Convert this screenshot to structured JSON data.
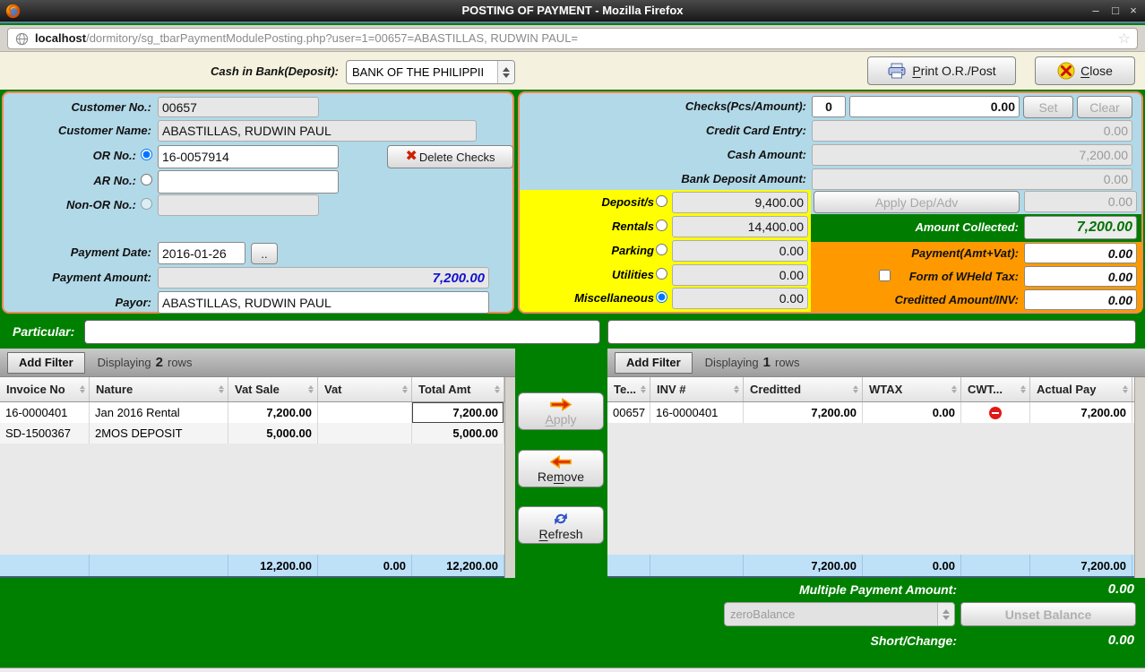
{
  "window": {
    "title": "POSTING OF PAYMENT - Mozilla Firefox",
    "minimize": "–",
    "maximize": "□",
    "close": "×"
  },
  "urlbar": {
    "host": "localhost",
    "path": "/dormitory/sg_tbarPaymentModulePosting.php?user=1=00657=ABASTILLAS, RUDWIN PAUL=",
    "star_icon": "☆"
  },
  "topbar": {
    "cash_in_bank_label": "Cash in Bank(Deposit):",
    "bank_value": "BANK OF THE PHILIPPII",
    "print_label": "Print O.R./Post",
    "print_hotkey": "P",
    "close_label": "Close",
    "close_hotkey": "C"
  },
  "customer": {
    "customer_no_label": "Customer No.:",
    "customer_no": "00657",
    "customer_name_label": "Customer Name:",
    "customer_name": "ABASTILLAS, RUDWIN PAUL",
    "or_no_label": "OR No.:",
    "or_no": "16-0057914",
    "or_selected": true,
    "ar_no_label": "AR No.:",
    "ar_no": "",
    "ar_selected": false,
    "non_or_label": "Non-OR No.:",
    "non_or": "",
    "non_or_selected": false,
    "delete_checks_label": "Delete Checks",
    "payment_date_label": "Payment Date:",
    "payment_date": "2016-01-26",
    "date_button": "..",
    "payment_amount_label": "Payment Amount:",
    "payment_amount": "7,200.00",
    "payor_label": "Payor:",
    "payor": "ABASTILLAS, RUDWIN PAUL"
  },
  "charges": {
    "checks_label": "Checks(Pcs/Amount):",
    "checks_pcs": "0",
    "checks_amount": "0.00",
    "set_label": "Set",
    "clear_label": "Clear",
    "credit_card_label": "Credit Card Entry:",
    "credit_card": "0.00",
    "cash_label": "Cash Amount:",
    "cash_amount": "7,200.00",
    "bank_deposit_label": "Bank Deposit Amount:",
    "bank_deposit": "0.00",
    "categories": [
      {
        "label": "Deposit/s",
        "value": "9,400.00",
        "selected": false
      },
      {
        "label": "Rentals",
        "value": "14,400.00",
        "selected": false
      },
      {
        "label": "Parking",
        "value": "0.00",
        "selected": false
      },
      {
        "label": "Utilities",
        "value": "0.00",
        "selected": false
      },
      {
        "label": "Miscellaneous",
        "value": "0.00",
        "selected": true
      }
    ],
    "apply_dep_label": "Apply Dep/Adv",
    "apply_dep_value": "0.00",
    "amount_collected_label": "Amount Collected:",
    "amount_collected": "7,200.00",
    "payment_vat_label": "Payment(Amt+Vat):",
    "payment_vat": "0.00",
    "wheld_label": "Form of WHeld Tax:",
    "wheld_value": "0.00",
    "wheld_checked": false,
    "creditted_label": "Creditted Amount/INV:",
    "creditted_value": "0.00"
  },
  "particular": {
    "label": "Particular:",
    "left_value": "",
    "right_value": ""
  },
  "invoice_table": {
    "add_filter_label": "Add Filter",
    "displaying_prefix": "Displaying",
    "row_count": "2",
    "rows_word": "rows",
    "columns": [
      "Invoice No",
      "Nature",
      "Vat Sale",
      "Vat",
      "Total Amt"
    ],
    "rows": [
      {
        "invoice_no": "16-0000401",
        "nature": "Jan 2016 Rental",
        "vat_sale": "7,200.00",
        "vat": "",
        "total_amt": "7,200.00"
      },
      {
        "invoice_no": "SD-1500367",
        "nature": "2MOS DEPOSIT",
        "vat_sale": "5,000.00",
        "vat": "",
        "total_amt": "5,000.00"
      }
    ],
    "total_vat_sale": "12,200.00",
    "total_vat": "0.00",
    "total_amt": "12,200.00"
  },
  "actions": {
    "apply_label": "Apply",
    "apply_hotkey": "A",
    "remove_label": "Remove",
    "remove_hotkey": "m",
    "refresh_label": "Refresh",
    "refresh_hotkey": "R"
  },
  "credit_table": {
    "add_filter_label": "Add Filter",
    "displaying_prefix": "Displaying",
    "row_count": "1",
    "rows_word": "rows",
    "columns": [
      "Te...",
      "INV #",
      "Creditted",
      "WTAX",
      "CWT...",
      "Actual Pay"
    ],
    "rows": [
      {
        "tenant": "00657",
        "inv_no": "16-0000401",
        "creditted": "7,200.00",
        "wtax": "0.00",
        "cwt_icon": "red-minus-circle",
        "actual_pay": "7,200.00"
      }
    ],
    "total_creditted": "7,200.00",
    "total_wtax": "0.00",
    "total_actual_pay": "7,200.00"
  },
  "footer": {
    "multiple_label": "Multiple Payment Amount:",
    "multiple_value": "0.00",
    "balance_option": "zeroBalance",
    "unset_label": "Unset Balance",
    "short_label": "Short/Change:",
    "short_value": "0.00"
  }
}
